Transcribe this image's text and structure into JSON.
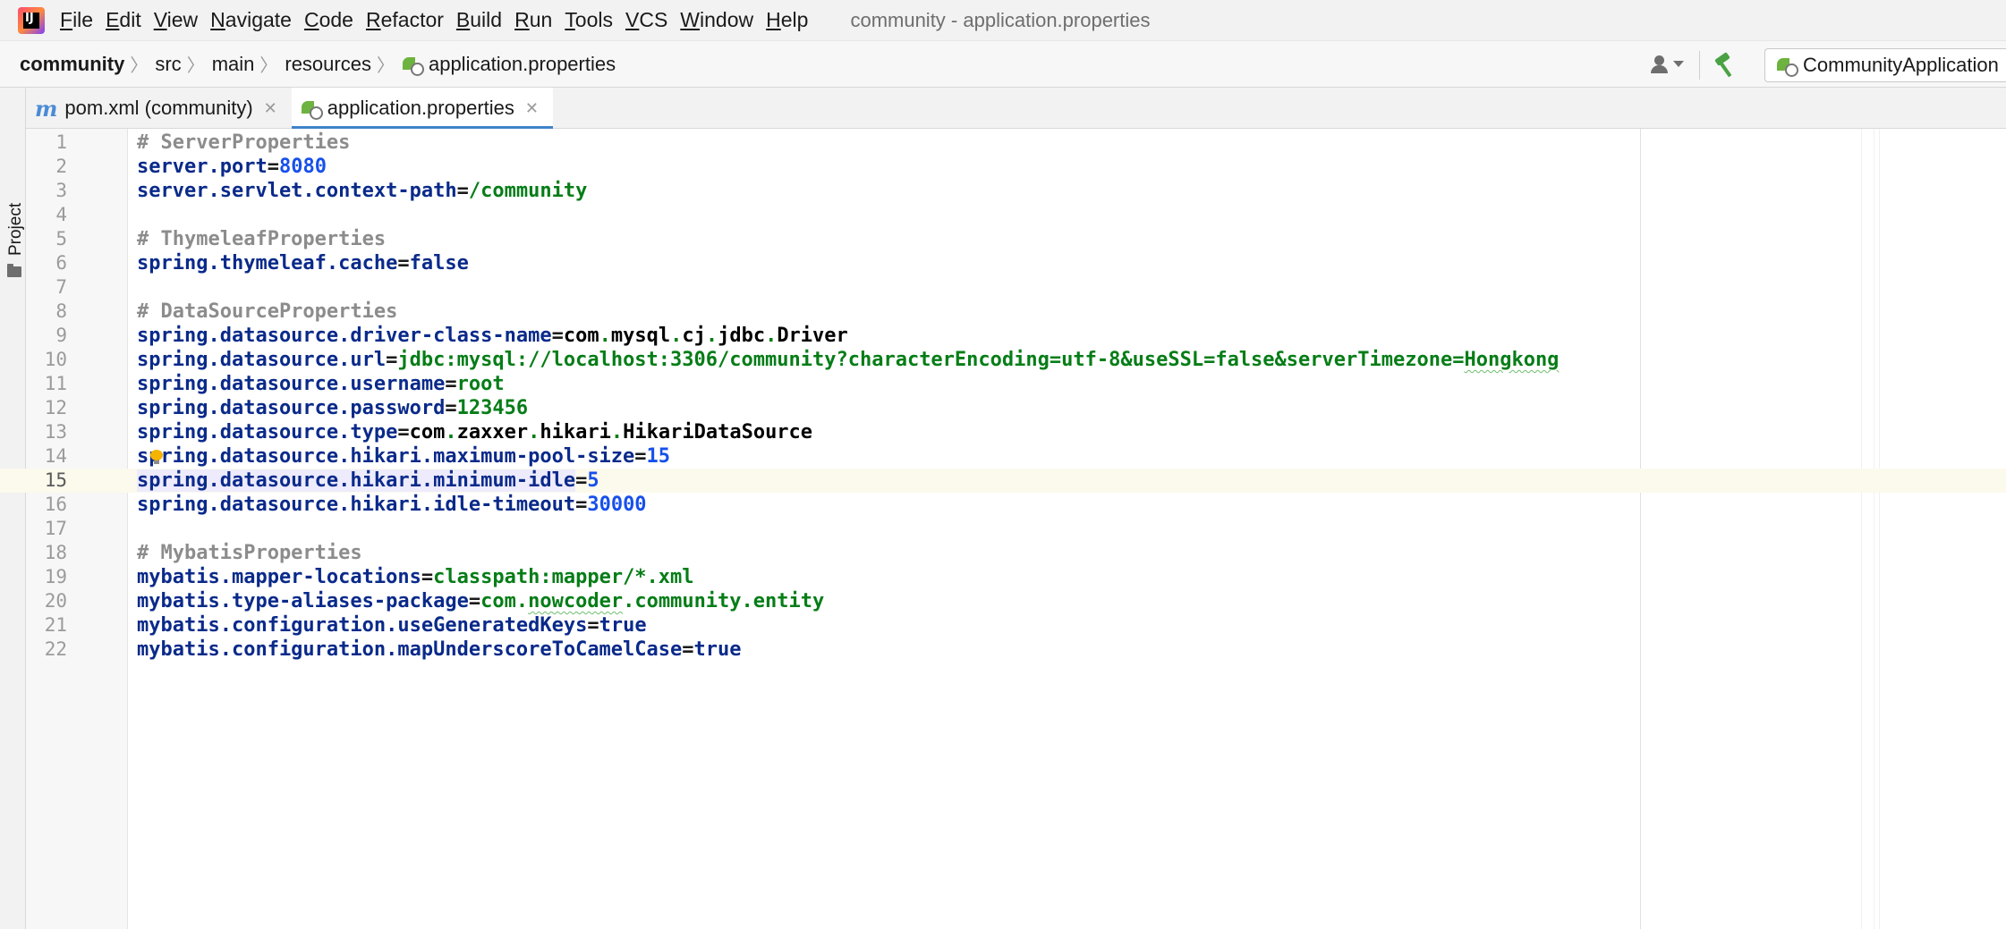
{
  "menubar": {
    "app_icon": "intellij-idea-icon",
    "items": [
      {
        "label": "File",
        "mnemonic": "F",
        "rest": "ile"
      },
      {
        "label": "Edit",
        "mnemonic": "E",
        "rest": "dit"
      },
      {
        "label": "View",
        "mnemonic": "V",
        "rest": "iew"
      },
      {
        "label": "Navigate",
        "mnemonic": "N",
        "rest": "avigate"
      },
      {
        "label": "Code",
        "mnemonic": "C",
        "rest": "ode"
      },
      {
        "label": "Refactor",
        "mnemonic": "R",
        "rest": "efactor"
      },
      {
        "label": "Build",
        "mnemonic": "B",
        "rest": "uild"
      },
      {
        "label": "Run",
        "mnemonic": "R",
        "rest": "un"
      },
      {
        "label": "Tools",
        "mnemonic": "T",
        "rest": "ools"
      },
      {
        "label": "VCS",
        "mnemonic": "V",
        "rest": "CS"
      },
      {
        "label": "Window",
        "mnemonic": "W",
        "rest": "indow"
      },
      {
        "label": "Help",
        "mnemonic": "H",
        "rest": "elp"
      }
    ],
    "window_title": "community - application.properties"
  },
  "breadcrumb": [
    "community",
    "src",
    "main",
    "resources",
    "application.properties"
  ],
  "toolbar": {
    "user_icon": "user-dropdown-icon",
    "build_icon": "hammer-icon",
    "run_config_label": "CommunityApplication"
  },
  "toolstrip": {
    "project_label": "Project",
    "project_icon": "folder-icon"
  },
  "tabs": [
    {
      "label": "pom.xml (community)",
      "icon": "maven-icon",
      "active": false
    },
    {
      "label": "application.properties",
      "icon": "spring-properties-icon",
      "active": true
    }
  ],
  "editor": {
    "current_line": 15,
    "lines": [
      {
        "n": "1",
        "tokens": [
          {
            "t": "# ServerProperties",
            "c": "cmt"
          }
        ]
      },
      {
        "n": "2",
        "tokens": [
          {
            "t": "server.port",
            "c": "k"
          },
          {
            "t": "=",
            "c": "eq"
          },
          {
            "t": "8080",
            "c": "num"
          }
        ]
      },
      {
        "n": "3",
        "tokens": [
          {
            "t": "server.servlet.context-path",
            "c": "k"
          },
          {
            "t": "=",
            "c": "eq"
          },
          {
            "t": "/community",
            "c": "str"
          }
        ]
      },
      {
        "n": "4",
        "tokens": []
      },
      {
        "n": "5",
        "tokens": [
          {
            "t": "# ThymeleafProperties",
            "c": "cmt"
          }
        ]
      },
      {
        "n": "6",
        "tokens": [
          {
            "t": "spring.thymeleaf.cache",
            "c": "k"
          },
          {
            "t": "=",
            "c": "eq"
          },
          {
            "t": "false",
            "c": "bool"
          }
        ]
      },
      {
        "n": "7",
        "tokens": []
      },
      {
        "n": "8",
        "tokens": [
          {
            "t": "# DataSourceProperties",
            "c": "cmt"
          }
        ]
      },
      {
        "n": "9",
        "tokens": [
          {
            "t": "spring.datasource.driver-class-name",
            "c": "k"
          },
          {
            "t": "=",
            "c": "eq"
          },
          {
            "t": "com",
            "c": "pkg"
          },
          {
            "t": ".",
            "c": "dot"
          },
          {
            "t": "mysql",
            "c": "pkg"
          },
          {
            "t": ".",
            "c": "dot"
          },
          {
            "t": "cj",
            "c": "pkg"
          },
          {
            "t": ".",
            "c": "dot"
          },
          {
            "t": "jdbc",
            "c": "pkg"
          },
          {
            "t": ".",
            "c": "dot"
          },
          {
            "t": "Driver",
            "c": "pkg"
          }
        ]
      },
      {
        "n": "10",
        "tokens": [
          {
            "t": "spring.datasource.url",
            "c": "k"
          },
          {
            "t": "=",
            "c": "eq"
          },
          {
            "t": "jdbc:mysql://localhost:3306/community?characterEncoding=utf-8&useSSL=false&serverTimezone=",
            "c": "str"
          },
          {
            "t": "Hongkong",
            "c": "str squig"
          }
        ]
      },
      {
        "n": "11",
        "tokens": [
          {
            "t": "spring.datasource.username",
            "c": "k"
          },
          {
            "t": "=",
            "c": "eq"
          },
          {
            "t": "root",
            "c": "str"
          }
        ]
      },
      {
        "n": "12",
        "tokens": [
          {
            "t": "spring.datasource.password",
            "c": "k"
          },
          {
            "t": "=",
            "c": "eq"
          },
          {
            "t": "123456",
            "c": "str"
          }
        ]
      },
      {
        "n": "13",
        "tokens": [
          {
            "t": "spring.datasource.type",
            "c": "k"
          },
          {
            "t": "=",
            "c": "eq"
          },
          {
            "t": "com",
            "c": "pkg"
          },
          {
            "t": ".",
            "c": "dot"
          },
          {
            "t": "zaxxer",
            "c": "pkg"
          },
          {
            "t": ".",
            "c": "dot"
          },
          {
            "t": "hikari",
            "c": "pkg"
          },
          {
            "t": ".",
            "c": "dot"
          },
          {
            "t": "HikariDataSource",
            "c": "pkg"
          }
        ]
      },
      {
        "n": "14",
        "tokens": [
          {
            "t": "spring.datasource.hikari.maximum-pool-size",
            "c": "k"
          },
          {
            "t": "=",
            "c": "eq"
          },
          {
            "t": "15",
            "c": "num"
          }
        ],
        "bulb": true
      },
      {
        "n": "15",
        "tokens": [
          {
            "t": "spring.datasource.hikari.minimum-idle",
            "c": "k hl"
          },
          {
            "t": "=",
            "c": "eq"
          },
          {
            "t": "5",
            "c": "num"
          }
        ]
      },
      {
        "n": "16",
        "tokens": [
          {
            "t": "spring.datasource.hikari.idle-timeout",
            "c": "k"
          },
          {
            "t": "=",
            "c": "eq"
          },
          {
            "t": "30000",
            "c": "num"
          }
        ]
      },
      {
        "n": "17",
        "tokens": []
      },
      {
        "n": "18",
        "tokens": [
          {
            "t": "# MybatisProperties",
            "c": "cmt"
          }
        ]
      },
      {
        "n": "19",
        "tokens": [
          {
            "t": "mybatis.mapper-locations",
            "c": "k"
          },
          {
            "t": "=",
            "c": "eq"
          },
          {
            "t": "classpath:mapper/*.xml",
            "c": "str"
          }
        ]
      },
      {
        "n": "20",
        "tokens": [
          {
            "t": "mybatis.type-aliases-package",
            "c": "k"
          },
          {
            "t": "=",
            "c": "eq"
          },
          {
            "t": "com",
            "c": "str"
          },
          {
            "t": ".",
            "c": "str"
          },
          {
            "t": "nowcoder",
            "c": "str squig"
          },
          {
            "t": ".community.entity",
            "c": "str"
          }
        ]
      },
      {
        "n": "21",
        "tokens": [
          {
            "t": "mybatis.configuration.useGeneratedKeys",
            "c": "k"
          },
          {
            "t": "=",
            "c": "eq"
          },
          {
            "t": "true",
            "c": "bool"
          }
        ]
      },
      {
        "n": "22",
        "tokens": [
          {
            "t": "mybatis.configuration.mapUnderscoreToCamelCase",
            "c": "k"
          },
          {
            "t": "=",
            "c": "eq"
          },
          {
            "t": "true",
            "c": "bool"
          }
        ]
      }
    ]
  },
  "colors": {
    "key": "#0a2a8a",
    "number": "#1750eb",
    "string": "#067d17",
    "comment": "#8c8c8c",
    "tab_underline": "#4083c9",
    "current_line_bg": "#fcfaed"
  }
}
